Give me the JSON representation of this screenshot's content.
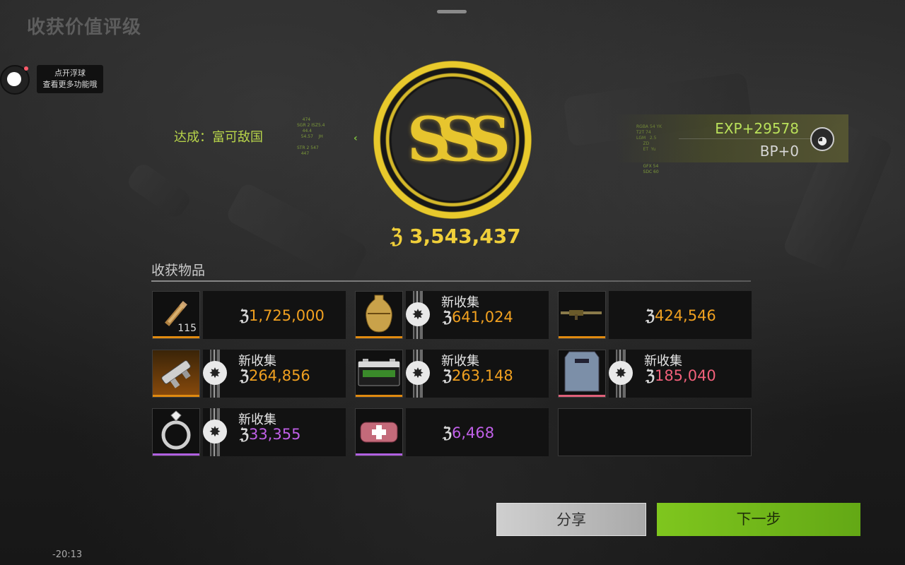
{
  "page_title": "收获价值评级",
  "float_tip": {
    "line1": "点开浮球",
    "line2": "查看更多功能哦"
  },
  "achievement": "达成：富可敌国",
  "grade": {
    "letters": "SSS",
    "color": "#e7c52e"
  },
  "total_value": "3,543,437",
  "rewards": {
    "exp": "EXP+29578",
    "bp": "BP+0"
  },
  "items_section": {
    "title": "收获物品"
  },
  "new_label": "新收集",
  "items": [
    {
      "name": "ammo",
      "qty": "115",
      "is_new": false,
      "value": "1,725,000",
      "value_color": "#f0a020",
      "bar_color": "#e08a10",
      "orange_bg": false,
      "icon": "ammo-icon"
    },
    {
      "name": "golden-vase",
      "qty": "",
      "is_new": true,
      "value": "641,024",
      "value_color": "#f0a020",
      "bar_color": "#e08a10",
      "orange_bg": false,
      "icon": "vase-icon"
    },
    {
      "name": "rifle",
      "qty": "",
      "is_new": false,
      "value": "424,546",
      "value_color": "#f0a020",
      "bar_color": "#e08a10",
      "orange_bg": false,
      "icon": "rifle-icon"
    },
    {
      "name": "drone-part",
      "qty": "",
      "is_new": true,
      "value": "264,856",
      "value_color": "#f0a020",
      "bar_color": "#e08a10",
      "orange_bg": true,
      "icon": "device-icon"
    },
    {
      "name": "car-battery",
      "qty": "",
      "is_new": true,
      "value": "263,148",
      "value_color": "#f0a020",
      "bar_color": "#e08a10",
      "orange_bg": false,
      "icon": "battery-icon"
    },
    {
      "name": "armor-plate",
      "qty": "",
      "is_new": true,
      "value": "185,040",
      "value_color": "#f0607a",
      "bar_color": "#e0607a",
      "orange_bg": false,
      "icon": "armor-plate-icon"
    },
    {
      "name": "ring",
      "qty": "",
      "is_new": true,
      "value": "33,355",
      "value_color": "#c060e8",
      "bar_color": "#b060e0",
      "orange_bg": false,
      "icon": "ring-icon"
    },
    {
      "name": "medkit",
      "qty": "",
      "is_new": false,
      "value": "6,468",
      "value_color": "#c060e8",
      "bar_color": "#b060e0",
      "orange_bg": false,
      "icon": "medkit-icon"
    }
  ],
  "buttons": {
    "share": "分享",
    "next": "下一步"
  },
  "clock": "-20:13"
}
